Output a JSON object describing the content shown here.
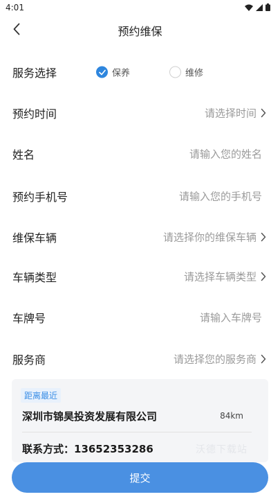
{
  "status_bar": {
    "time": "4:01"
  },
  "header": {
    "title": "预约维保"
  },
  "form": {
    "service_select": {
      "label": "服务选择",
      "options": [
        {
          "label": "保养",
          "checked": true
        },
        {
          "label": "维修",
          "checked": false
        }
      ]
    },
    "appointment_time": {
      "label": "预约时间",
      "placeholder": "请选择时间"
    },
    "name": {
      "label": "姓名",
      "placeholder": "请输入您的姓名"
    },
    "phone": {
      "label": "预约手机号",
      "placeholder": "请输入您的手机号"
    },
    "vehicle": {
      "label": "维保车辆",
      "placeholder": "请选择你的维保车辆"
    },
    "vehicle_type": {
      "label": "车辆类型",
      "placeholder": "请选择车辆类型"
    },
    "plate": {
      "label": "车牌号",
      "placeholder": "请输入车牌号"
    },
    "provider": {
      "label": "服务商",
      "placeholder": "请选择您的服务商"
    }
  },
  "provider_card": {
    "badge": "距离最近",
    "company": "深圳市锦昊投资发展有限公司",
    "distance": "84km",
    "contact": "联系方式：13652353286",
    "watermark": "沃德下载站"
  },
  "submit_label": "提交",
  "colors": {
    "accent": "#4a90e2",
    "radio_checked": "#2e86de",
    "placeholder": "#9a9a9a"
  }
}
